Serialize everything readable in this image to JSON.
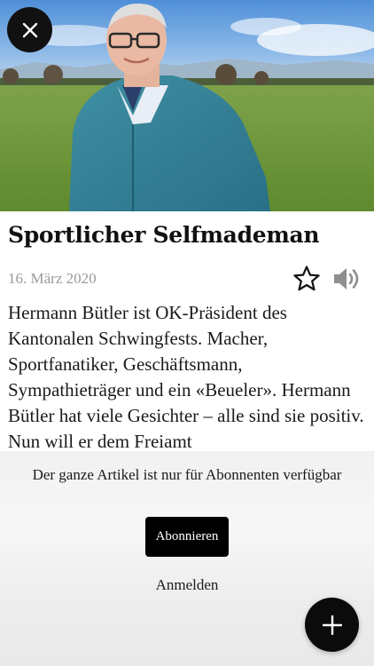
{
  "article": {
    "title": "Sportlicher Selfmademan",
    "date": "16. März 2020",
    "body": "Hermann Bütler ist OK-Präsident des Kantonalen Schwingfests. Macher, Sportfanatiker, Geschäftsmann, Sympathieträger und ein «Beueler». Hermann Bütler hat viele Gesichter – alle sind sie positiv. Nun will er dem Freiamt"
  },
  "paywall": {
    "message": "Der ganze Artikel ist nur für Abonnenten verfügbar",
    "subscribe_label": "Abonnieren",
    "login_label": "Anmelden"
  },
  "icons": {
    "close": "close-icon",
    "favorite": "star-outline-icon",
    "listen": "speaker-icon",
    "add": "plus-icon"
  },
  "colors": {
    "button_bg": "#000000",
    "date_text": "#9a9a9a",
    "paywall_bg": "#f1f1f1"
  }
}
